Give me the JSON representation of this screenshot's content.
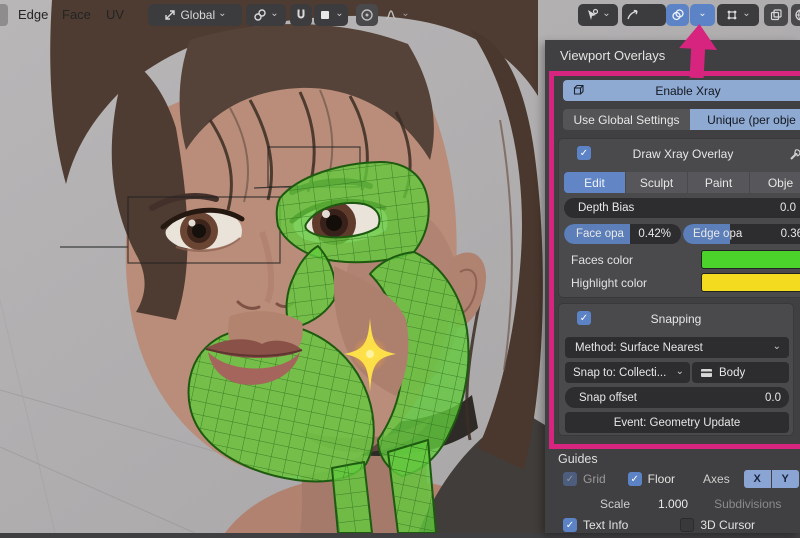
{
  "header": {
    "mode_edge": "Edge",
    "mode_face": "Face",
    "mode_uv": "UV",
    "orientation_label": "Global"
  },
  "overlay_panel": {
    "title": "Viewport Overlays",
    "enable_xray_label": "Enable Xray",
    "use_global_label": "Use Global Settings",
    "unique_label": "Unique (per obje",
    "draw_xray": {
      "title": "Draw Xray Overlay",
      "tab_edit": "Edit",
      "tab_sculpt": "Sculpt",
      "tab_paint": "Paint",
      "tab_object": "Obje",
      "depth_bias_label": "Depth Bias",
      "depth_bias_value": "0.0",
      "face_opa_label": "Face opa",
      "face_opa_value": "0.42%",
      "edge_opa_label": "Edge opa",
      "edge_opa_value": "0.36",
      "faces_color_label": "Faces color",
      "highlight_color_label": "Highlight color"
    },
    "snapping": {
      "title": "Snapping",
      "method_label": "Method: Surface Nearest",
      "snap_to_label": "Snap to: Collecti...",
      "snap_target": "Body",
      "snap_offset_label": "Snap offset",
      "snap_offset_value": "0.0",
      "event_label": "Event: Geometry Update"
    },
    "guides": {
      "title": "Guides",
      "grid_label": "Grid",
      "floor_label": "Floor",
      "axes_label": "Axes",
      "axis_x": "X",
      "axis_y": "Y",
      "scale_label": "Scale",
      "scale_value": "1.000",
      "subdivisions_label": "Subdivisions",
      "text_info_label": "Text Info",
      "cursor_label": "3D Cursor"
    }
  },
  "colors": {
    "accent_pink": "#d6247f",
    "selection_blue": "#5c83c6",
    "light_blue_button": "#8ea9d2",
    "faces_color": "#4bd32b",
    "highlight_color": "#f3dc20"
  },
  "icons": {
    "chevron_down": "⌄",
    "check": "✓"
  }
}
